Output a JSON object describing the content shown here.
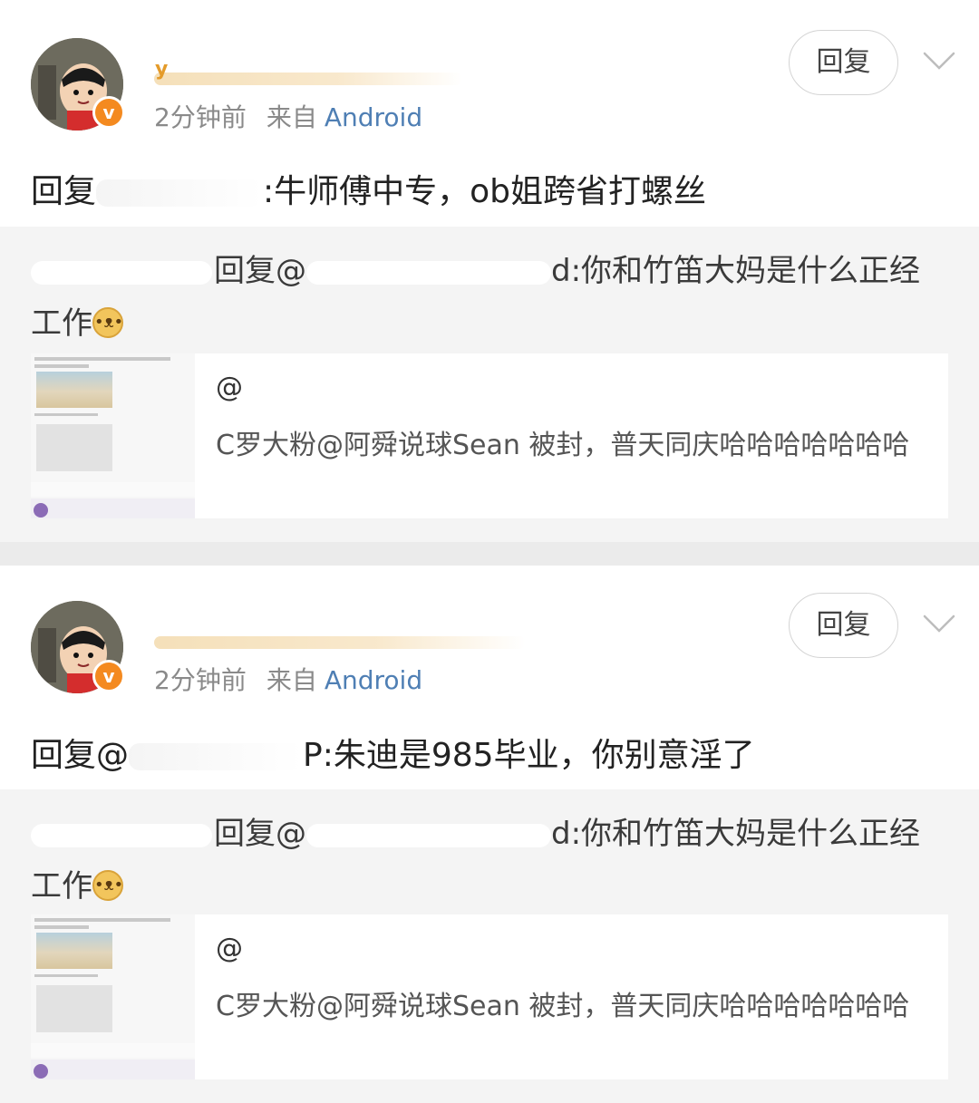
{
  "posts": [
    {
      "username_initial": "y",
      "time": "2分钟前",
      "from_label": "来自",
      "source": "Android",
      "reply_button": "回复",
      "badge": "v",
      "text_prefix": "回复",
      "text_body": ":牛师傅中专，ob姐跨省打螺丝",
      "quote": {
        "prefix": "回复@",
        "body": "d:你和竹笛大妈是什么正经",
        "line2": "工作",
        "card": {
          "handle": "@",
          "text": "C罗大粉@阿舜说球Sean 被封，普天同庆哈哈哈哈哈哈哈"
        }
      }
    },
    {
      "username_initial": "",
      "time": "2分钟前",
      "from_label": "来自",
      "source": "Android",
      "reply_button": "回复",
      "badge": "v",
      "text_prefix": "回复@",
      "text_body": "P:朱迪是985毕业，你别意淫了",
      "quote": {
        "prefix": "回复@",
        "body": "d:你和竹笛大妈是什么正经",
        "line2": "工作",
        "card": {
          "handle": "@",
          "text": "C罗大粉@阿舜说球Sean 被封，普天同庆哈哈哈哈哈哈哈"
        }
      }
    }
  ],
  "icons": {
    "chevron": "chevron-down-icon",
    "emoji": "doge-emoji-icon",
    "badge": "verified-badge-icon"
  },
  "colors": {
    "link_blue": "#4f7fb4",
    "badge_orange": "#f48a20",
    "background": "#ebebeb",
    "quote_bg": "#f4f4f4"
  }
}
